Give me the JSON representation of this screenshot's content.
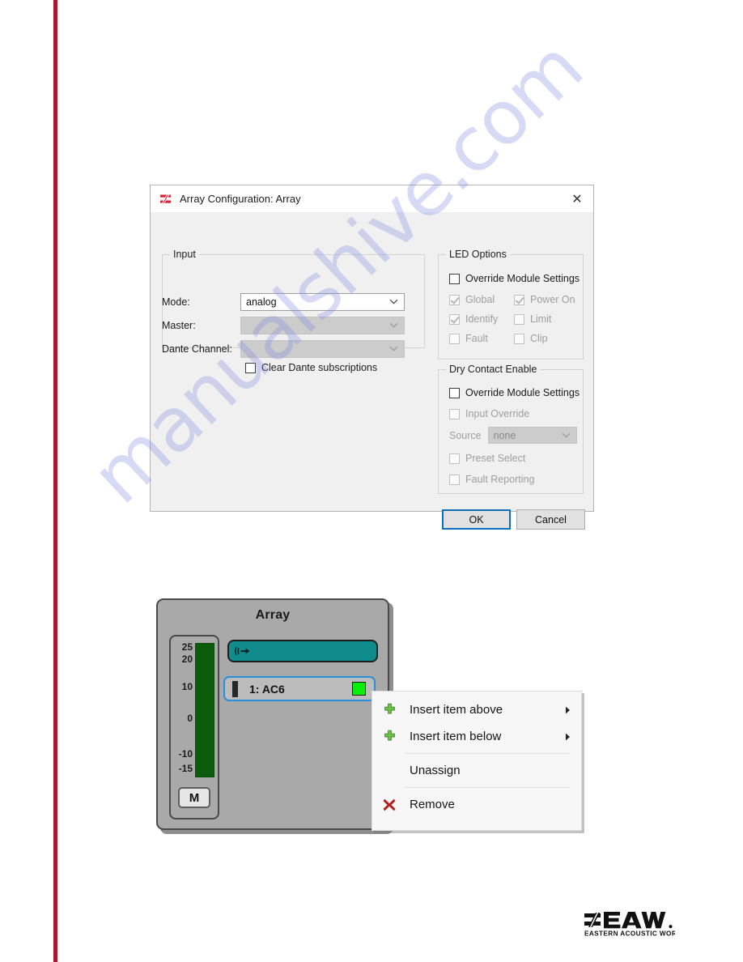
{
  "page": {
    "spine_color": "#a8192f",
    "background": "#ffffff"
  },
  "watermark": {
    "text": "manualshive.com",
    "color": "#828cdc"
  },
  "dialog": {
    "icon": "eaw-app-icon",
    "title": "Array Configuration: Array",
    "close_label": "✕",
    "input_group": {
      "title": "Input",
      "fields": [
        {
          "label": "Mode:",
          "value": "analog",
          "enabled": true
        },
        {
          "label": "Master:",
          "value": "",
          "enabled": false
        },
        {
          "label": "Dante Channel:",
          "value": "",
          "enabled": false
        }
      ],
      "clear_dante": {
        "label": "Clear Dante subscriptions",
        "checked": false,
        "enabled": true
      }
    },
    "led_group": {
      "title": "LED Options",
      "override": {
        "label": "Override Module Settings",
        "checked": false,
        "enabled": true
      },
      "options": [
        {
          "label": "Global",
          "checked": true,
          "enabled": false
        },
        {
          "label": "Power On",
          "checked": true,
          "enabled": false
        },
        {
          "label": "Identify",
          "checked": true,
          "enabled": false
        },
        {
          "label": "Limit",
          "checked": false,
          "enabled": false
        },
        {
          "label": "Fault",
          "checked": false,
          "enabled": false
        },
        {
          "label": "Clip",
          "checked": false,
          "enabled": false
        }
      ]
    },
    "dry_contact_group": {
      "title": "Dry Contact Enable",
      "override": {
        "label": "Override Module Settings",
        "checked": false,
        "enabled": true
      },
      "input_override": {
        "label": "Input Override",
        "checked": false,
        "enabled": false
      },
      "source": {
        "label": "Source",
        "value": "none",
        "enabled": false
      },
      "preset_select": {
        "label": "Preset Select",
        "checked": false,
        "enabled": false
      },
      "fault_reporting": {
        "label": "Fault Reporting",
        "checked": false,
        "enabled": false
      }
    },
    "buttons": {
      "ok": "OK",
      "cancel": "Cancel"
    }
  },
  "array_panel": {
    "title": "Array",
    "meter": {
      "ticks": [
        "25",
        "20",
        "10",
        "0",
        "-10",
        "-15"
      ],
      "bar_color": "#0d5c0d",
      "fill_percent": 100
    },
    "mute_button": "M",
    "input_bar": {
      "icon": "audio-input-icon",
      "color": "#108c8c"
    },
    "module": {
      "label": "1: AC6",
      "led_color": "#0bee0b",
      "selected": true
    }
  },
  "context_menu": {
    "items": [
      {
        "label": "Insert item above",
        "icon": "plus-green-icon",
        "submenu": true
      },
      {
        "label": "Insert item below",
        "icon": "plus-green-icon",
        "submenu": true
      },
      {
        "label": "Unassign",
        "icon": "",
        "submenu": false
      },
      {
        "label": "Remove",
        "icon": "cross-red-icon",
        "submenu": false
      }
    ]
  },
  "footer_logo": {
    "brand": "EAW",
    "tagline": "EASTERN ACOUSTIC WORKS"
  }
}
